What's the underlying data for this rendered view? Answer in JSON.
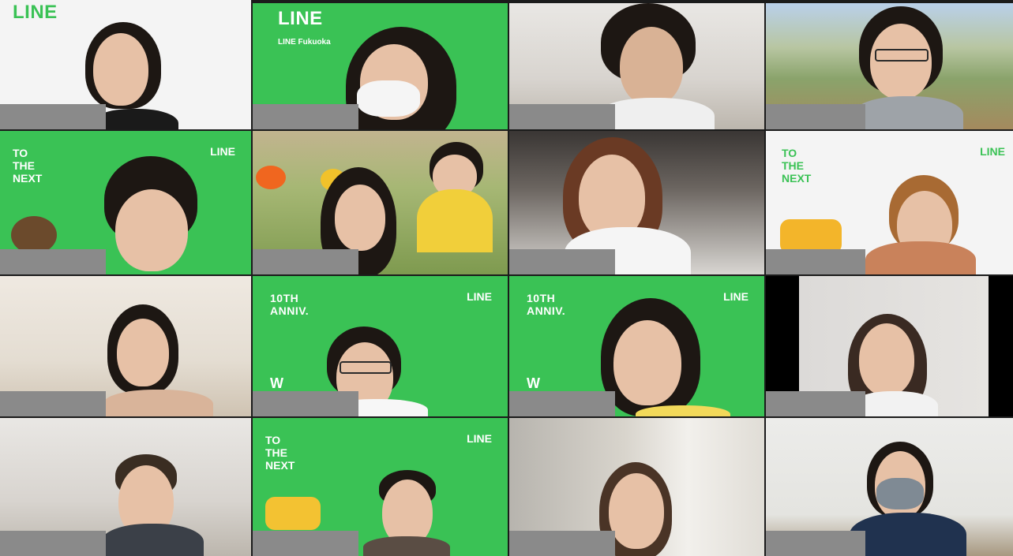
{
  "tiles": [
    {
      "brand": "LINE"
    },
    {
      "brand": "LINE",
      "sub": "LINE Fukuoka"
    },
    {},
    {},
    {
      "slogan": "TO\nTHE\nNEXT",
      "corner": "LINE"
    },
    {},
    {},
    {
      "slogan": "TO\nTHE\nNEXT",
      "corner": "LINE"
    },
    {},
    {
      "anniv": "10TH\nANNIV.",
      "corner": "LINE"
    },
    {
      "anniv": "10TH\nANNIV.",
      "corner": "LINE"
    },
    {},
    {},
    {
      "slogan": "TO\nTHE\nNEXT",
      "corner": "LINE"
    },
    {},
    {}
  ],
  "colors": {
    "line_green": "#3ac255",
    "nameplate": "#8a8a8a"
  }
}
